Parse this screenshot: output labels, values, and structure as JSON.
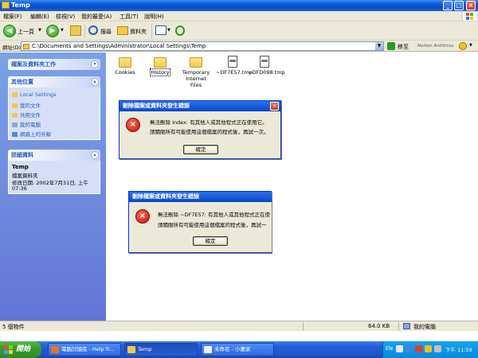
{
  "window": {
    "title": "Temp"
  },
  "menu": [
    "檔案(F)",
    "編輯(E)",
    "檢視(V)",
    "我的最愛(A)",
    "工具(T)",
    "說明(H)"
  ],
  "toolbar": {
    "back": "上一頁",
    "search": "搜尋",
    "folders": "資料夾"
  },
  "address": {
    "label": "網址(D)",
    "path": "C:\\Documents and Settings\\Administrator\\Local Settings\\Temp",
    "go": "移至",
    "norton": "Norton AntiVirus"
  },
  "leftpane": {
    "tasks_header": "檔案及資料夾工作",
    "other_header": "其他位置",
    "other_items": [
      "Local Settings",
      "我的文件",
      "共用文件",
      "我的電腦",
      "網路上的芳鄰"
    ],
    "details_header": "詳細資料",
    "details_name": "Temp",
    "details_type": "檔案資料夾",
    "details_modified": "修改日期: 2002年7月31日, 上午",
    "details_time": "07:36"
  },
  "files": [
    {
      "name": "Cookies",
      "kind": "folder"
    },
    {
      "name": "History",
      "kind": "folder"
    },
    {
      "name": "Temporary Internet Files",
      "kind": "folder"
    },
    {
      "name": "~DF7E57.tmp",
      "kind": "tmp"
    },
    {
      "name": "~DFD098.tmp",
      "kind": "tmp"
    }
  ],
  "dialog1": {
    "title": "刪除檔案或資料夾發生錯誤",
    "line1": "無法刪除 index: 有其他人或其他程式正在使用它。",
    "line2": "請關閉所有可能使用這個檔案的程式後，再試一次。",
    "ok": "確定"
  },
  "dialog2": {
    "title": "刪除檔案或資料夾發生錯誤",
    "line1": "無法刪除 ~DF7E57: 有其他人或其他程式正在使",
    "line2": "請關閉所有可能使用這個檔案的程式後，再試一",
    "ok": "確定"
  },
  "statusbar": {
    "objects": "5 個物件",
    "size": "64.0 KB",
    "location": "我的電腦"
  },
  "taskbar": {
    "start": "開始",
    "tasks": [
      "電腦討論區 - Help fr...",
      "Temp",
      "未命名 - 小畫家"
    ],
    "lang": "EN",
    "clock": "下午 11:59"
  }
}
